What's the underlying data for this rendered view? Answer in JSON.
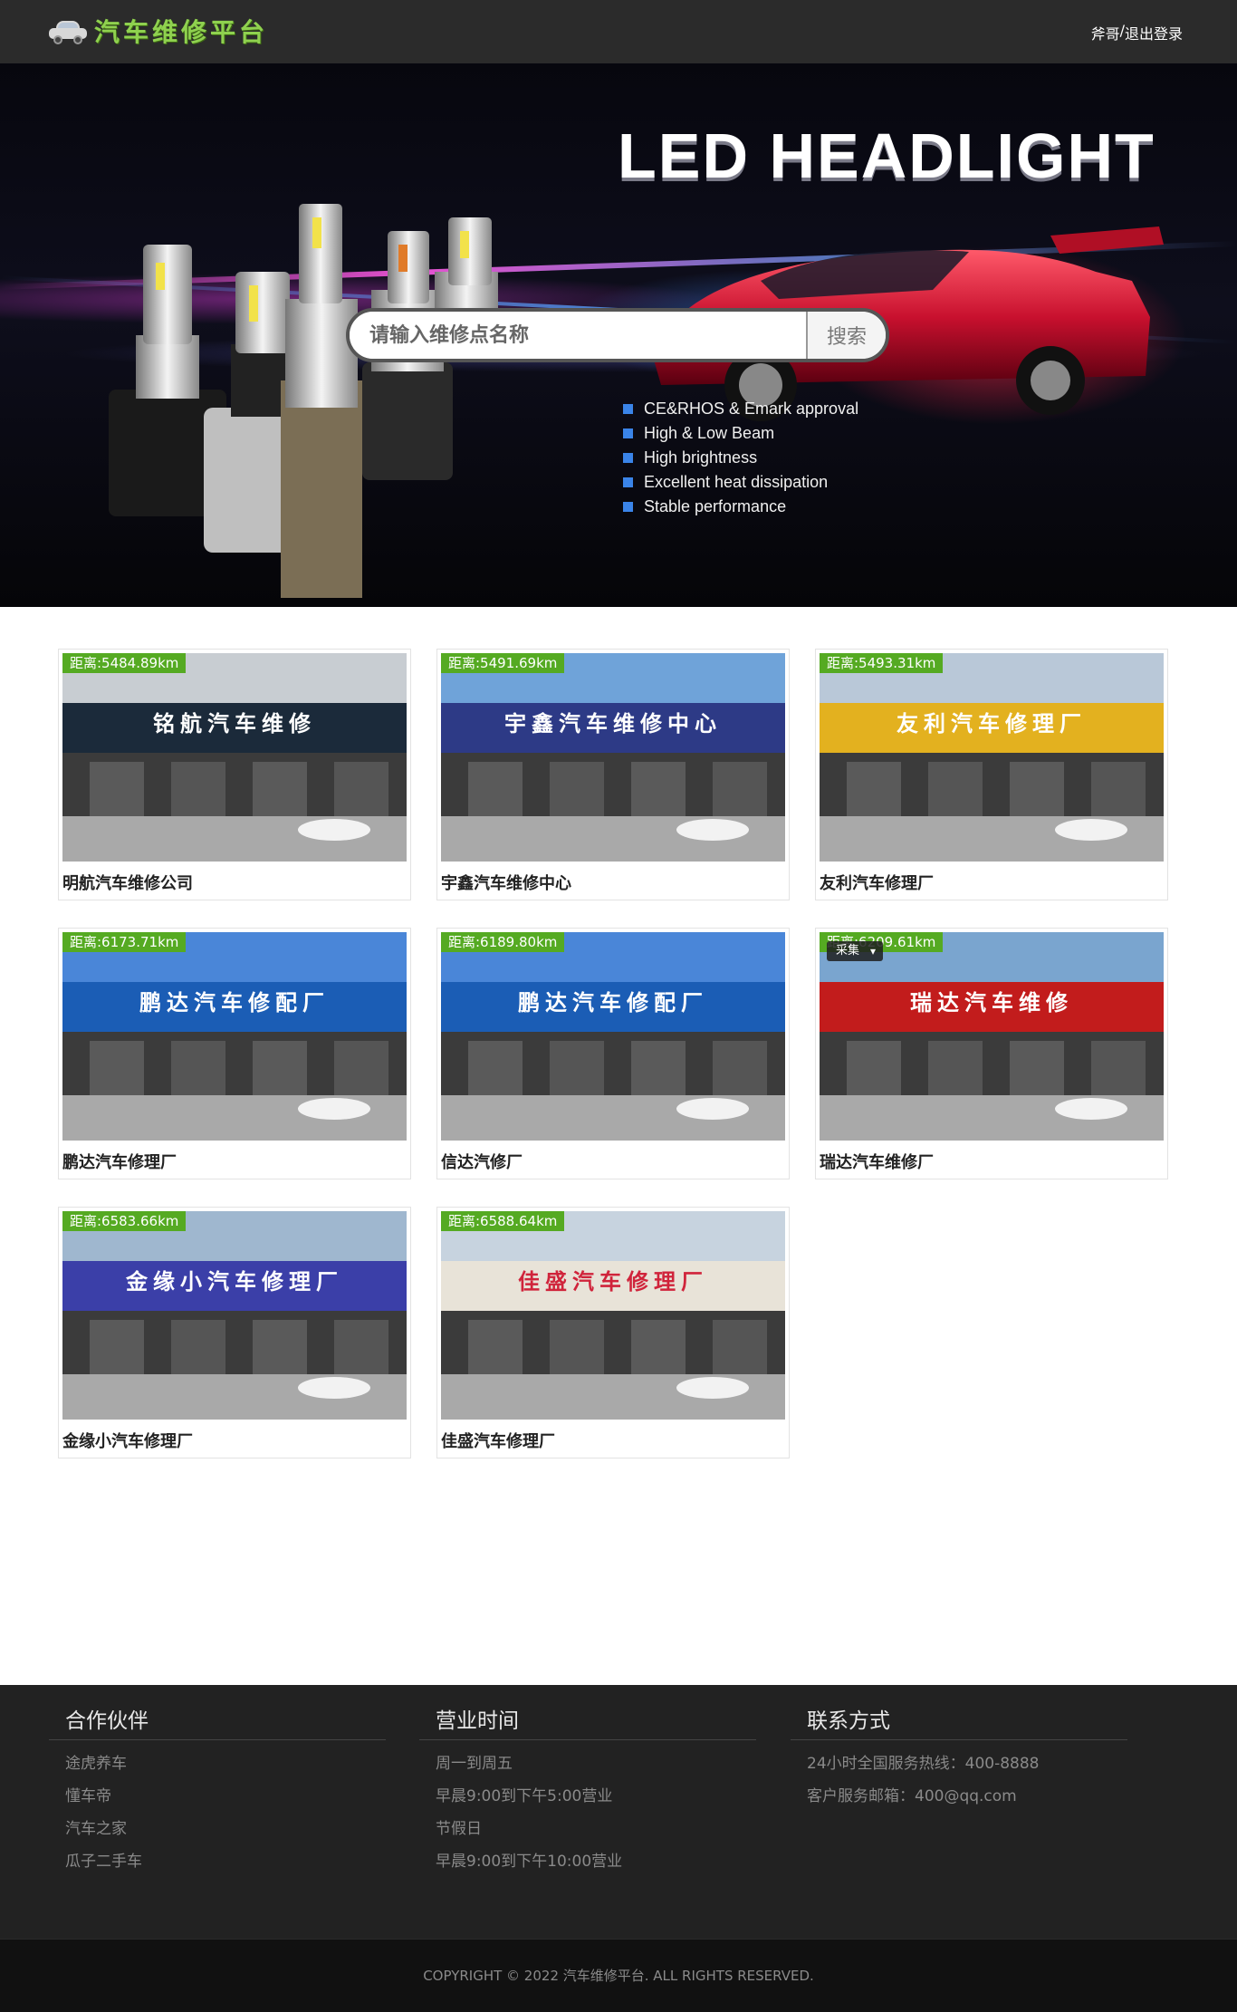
{
  "header": {
    "logo_text": "汽车维修平台",
    "user_name": "斧哥",
    "separator": "/",
    "logout_label": "退出登录"
  },
  "banner": {
    "title": "LED HEADLIGHT",
    "search_placeholder": "请输入维修点名称",
    "search_button": "搜索",
    "features": [
      "CE&RHOS & Emark approval",
      "High & Low Beam",
      "High brightness",
      "Excellent heat dissipation",
      "Stable performance"
    ]
  },
  "shops": [
    {
      "distance": "距离:5484.89km",
      "name": "明航汽车维修公司",
      "sign": "铭航汽车维修",
      "sign_color": "#1b2a3a",
      "sky": "#c8cdd2"
    },
    {
      "distance": "距离:5491.69km",
      "name": "宇鑫汽车维修中心",
      "sign": "宇鑫汽车维修中心",
      "sign_color": "#2d3a86",
      "sky": "#6fa3d9"
    },
    {
      "distance": "距离:5493.31km",
      "name": "友利汽车修理厂",
      "sign": "友利汽车修理厂",
      "sign_color": "#e3b11f",
      "sky": "#b9c8d8"
    },
    {
      "distance": "距离:6173.71km",
      "name": "鹏达汽车修理厂",
      "sign": "鹏达汽车修配厂",
      "sign_color": "#1b5db5",
      "sky": "#4a86d8"
    },
    {
      "distance": "距离:6189.80km",
      "name": "信达汽修厂",
      "sign": "鹏达汽车修配厂",
      "sign_color": "#1b5db5",
      "sky": "#4a86d8"
    },
    {
      "distance": "距离:6209.61km",
      "name": "瑞达汽车维修厂",
      "sign": "瑞达汽车维修",
      "sign_color": "#c21c1c",
      "sky": "#7aa5cf"
    },
    {
      "distance": "距离:6583.66km",
      "name": "金缘小汽车修理厂",
      "sign": "金缘小汽车修理厂",
      "sign_color": "#3b3fa8",
      "sky": "#9fb7cf"
    },
    {
      "distance": "距离:6588.64km",
      "name": "佳盛汽车修理厂",
      "sign": "佳盛汽车修理厂",
      "sign_color": "#e8e3d8",
      "sky": "#c7d3df"
    }
  ],
  "overlay_chip": "采集",
  "footer": {
    "partners": {
      "title": "合作伙伴",
      "items": [
        "途虎养车",
        "懂车帝",
        "汽车之家",
        "瓜子二手车"
      ]
    },
    "hours": {
      "title": "营业时间",
      "items": [
        "周一到周五",
        "早晨9:00到下午5:00营业",
        "节假日",
        "早晨9:00到下午10:00营业"
      ]
    },
    "contact": {
      "title": "联系方式",
      "items": [
        "24小时全国服务热线：400-8888",
        "客户服务邮箱：400@qq.com"
      ]
    },
    "copyright": "COPYRIGHT © 2022 汽车维修平台. ALL RIGHTS RESERVED."
  }
}
